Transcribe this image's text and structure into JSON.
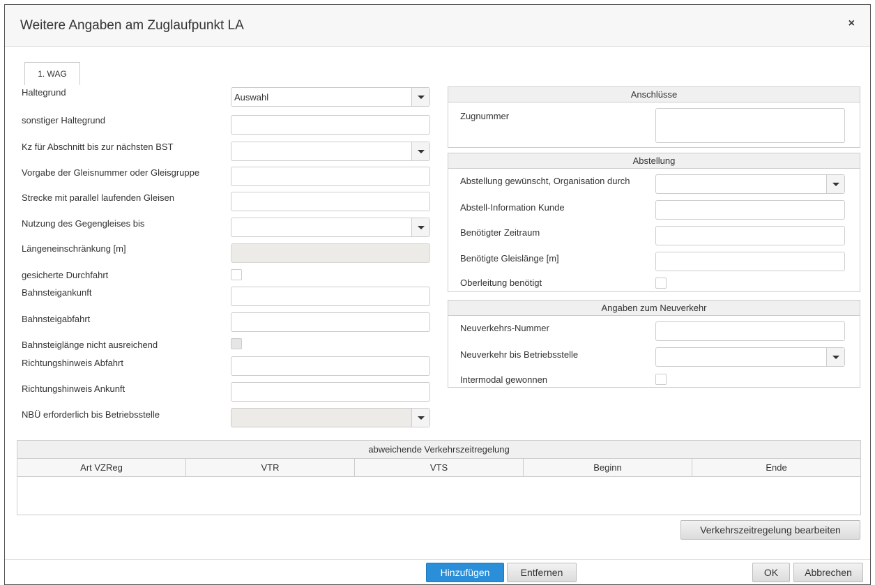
{
  "dialog": {
    "title": "Weitere Angaben am Zuglaufpunkt LA",
    "close_icon": "×"
  },
  "tab": {
    "label": "1. WAG"
  },
  "left_form": {
    "haltegrund": {
      "label": "Haltegrund",
      "value": "Auswahl"
    },
    "sonstiger_haltegrund": {
      "label": "sonstiger Haltegrund"
    },
    "kz_abschnitt": {
      "label": "Kz für Abschnitt bis zur nächsten BST"
    },
    "gleisnummer": {
      "label": "Vorgabe der Gleisnummer oder Gleisgruppe"
    },
    "strecke_parallel": {
      "label": "Strecke mit parallel laufenden Gleisen"
    },
    "gegengleis": {
      "label": "Nutzung des Gegengleises bis"
    },
    "laengeneinschraenkung": {
      "label": "Längeneinschränkung [m]"
    },
    "gesicherte_durchfahrt": {
      "label": "gesicherte Durchfahrt"
    },
    "bahnsteigankunft": {
      "label": "Bahnsteigankunft"
    },
    "bahnsteigabfahrt": {
      "label": "Bahnsteigabfahrt"
    },
    "bahnsteiglaenge": {
      "label": "Bahnsteiglänge nicht ausreichend"
    },
    "richtung_abfahrt": {
      "label": "Richtungshinweis Abfahrt"
    },
    "richtung_ankunft": {
      "label": "Richtungshinweis Ankunft"
    },
    "nbue": {
      "label": "NBÜ erforderlich bis Betriebsstelle"
    }
  },
  "anschluesse": {
    "title": "Anschlüsse",
    "zugnummer_label": "Zugnummer"
  },
  "abstellung": {
    "title": "Abstellung",
    "organisation_label": "Abstellung gewünscht, Organisation durch",
    "information_label": "Abstell-Information Kunde",
    "zeitraum_label": "Benötigter Zeitraum",
    "gleislaenge_label": "Benötigte Gleislänge [m]",
    "oberleitung_label": "Oberleitung benötigt"
  },
  "neuverkehr": {
    "title": "Angaben zum Neuverkehr",
    "nummer_label": "Neuverkehrs-Nummer",
    "betriebsstelle_label": "Neuverkehr bis Betriebsstelle",
    "intermodal_label": "Intermodal gewonnen"
  },
  "grid": {
    "title": "abweichende Verkehrszeitregelung",
    "columns": [
      "Art VZReg",
      "VTR",
      "VTS",
      "Beginn",
      "Ende"
    ]
  },
  "buttons": {
    "bearbeiten": "Verkehrszeitregelung bearbeiten",
    "hinzufuegen": "Hinzufügen",
    "entfernen": "Entfernen",
    "ok": "OK",
    "abbrechen": "Abbrechen"
  },
  "colors": {
    "primary": "#2a8fd8",
    "disabled_field": "#ecebe7"
  }
}
